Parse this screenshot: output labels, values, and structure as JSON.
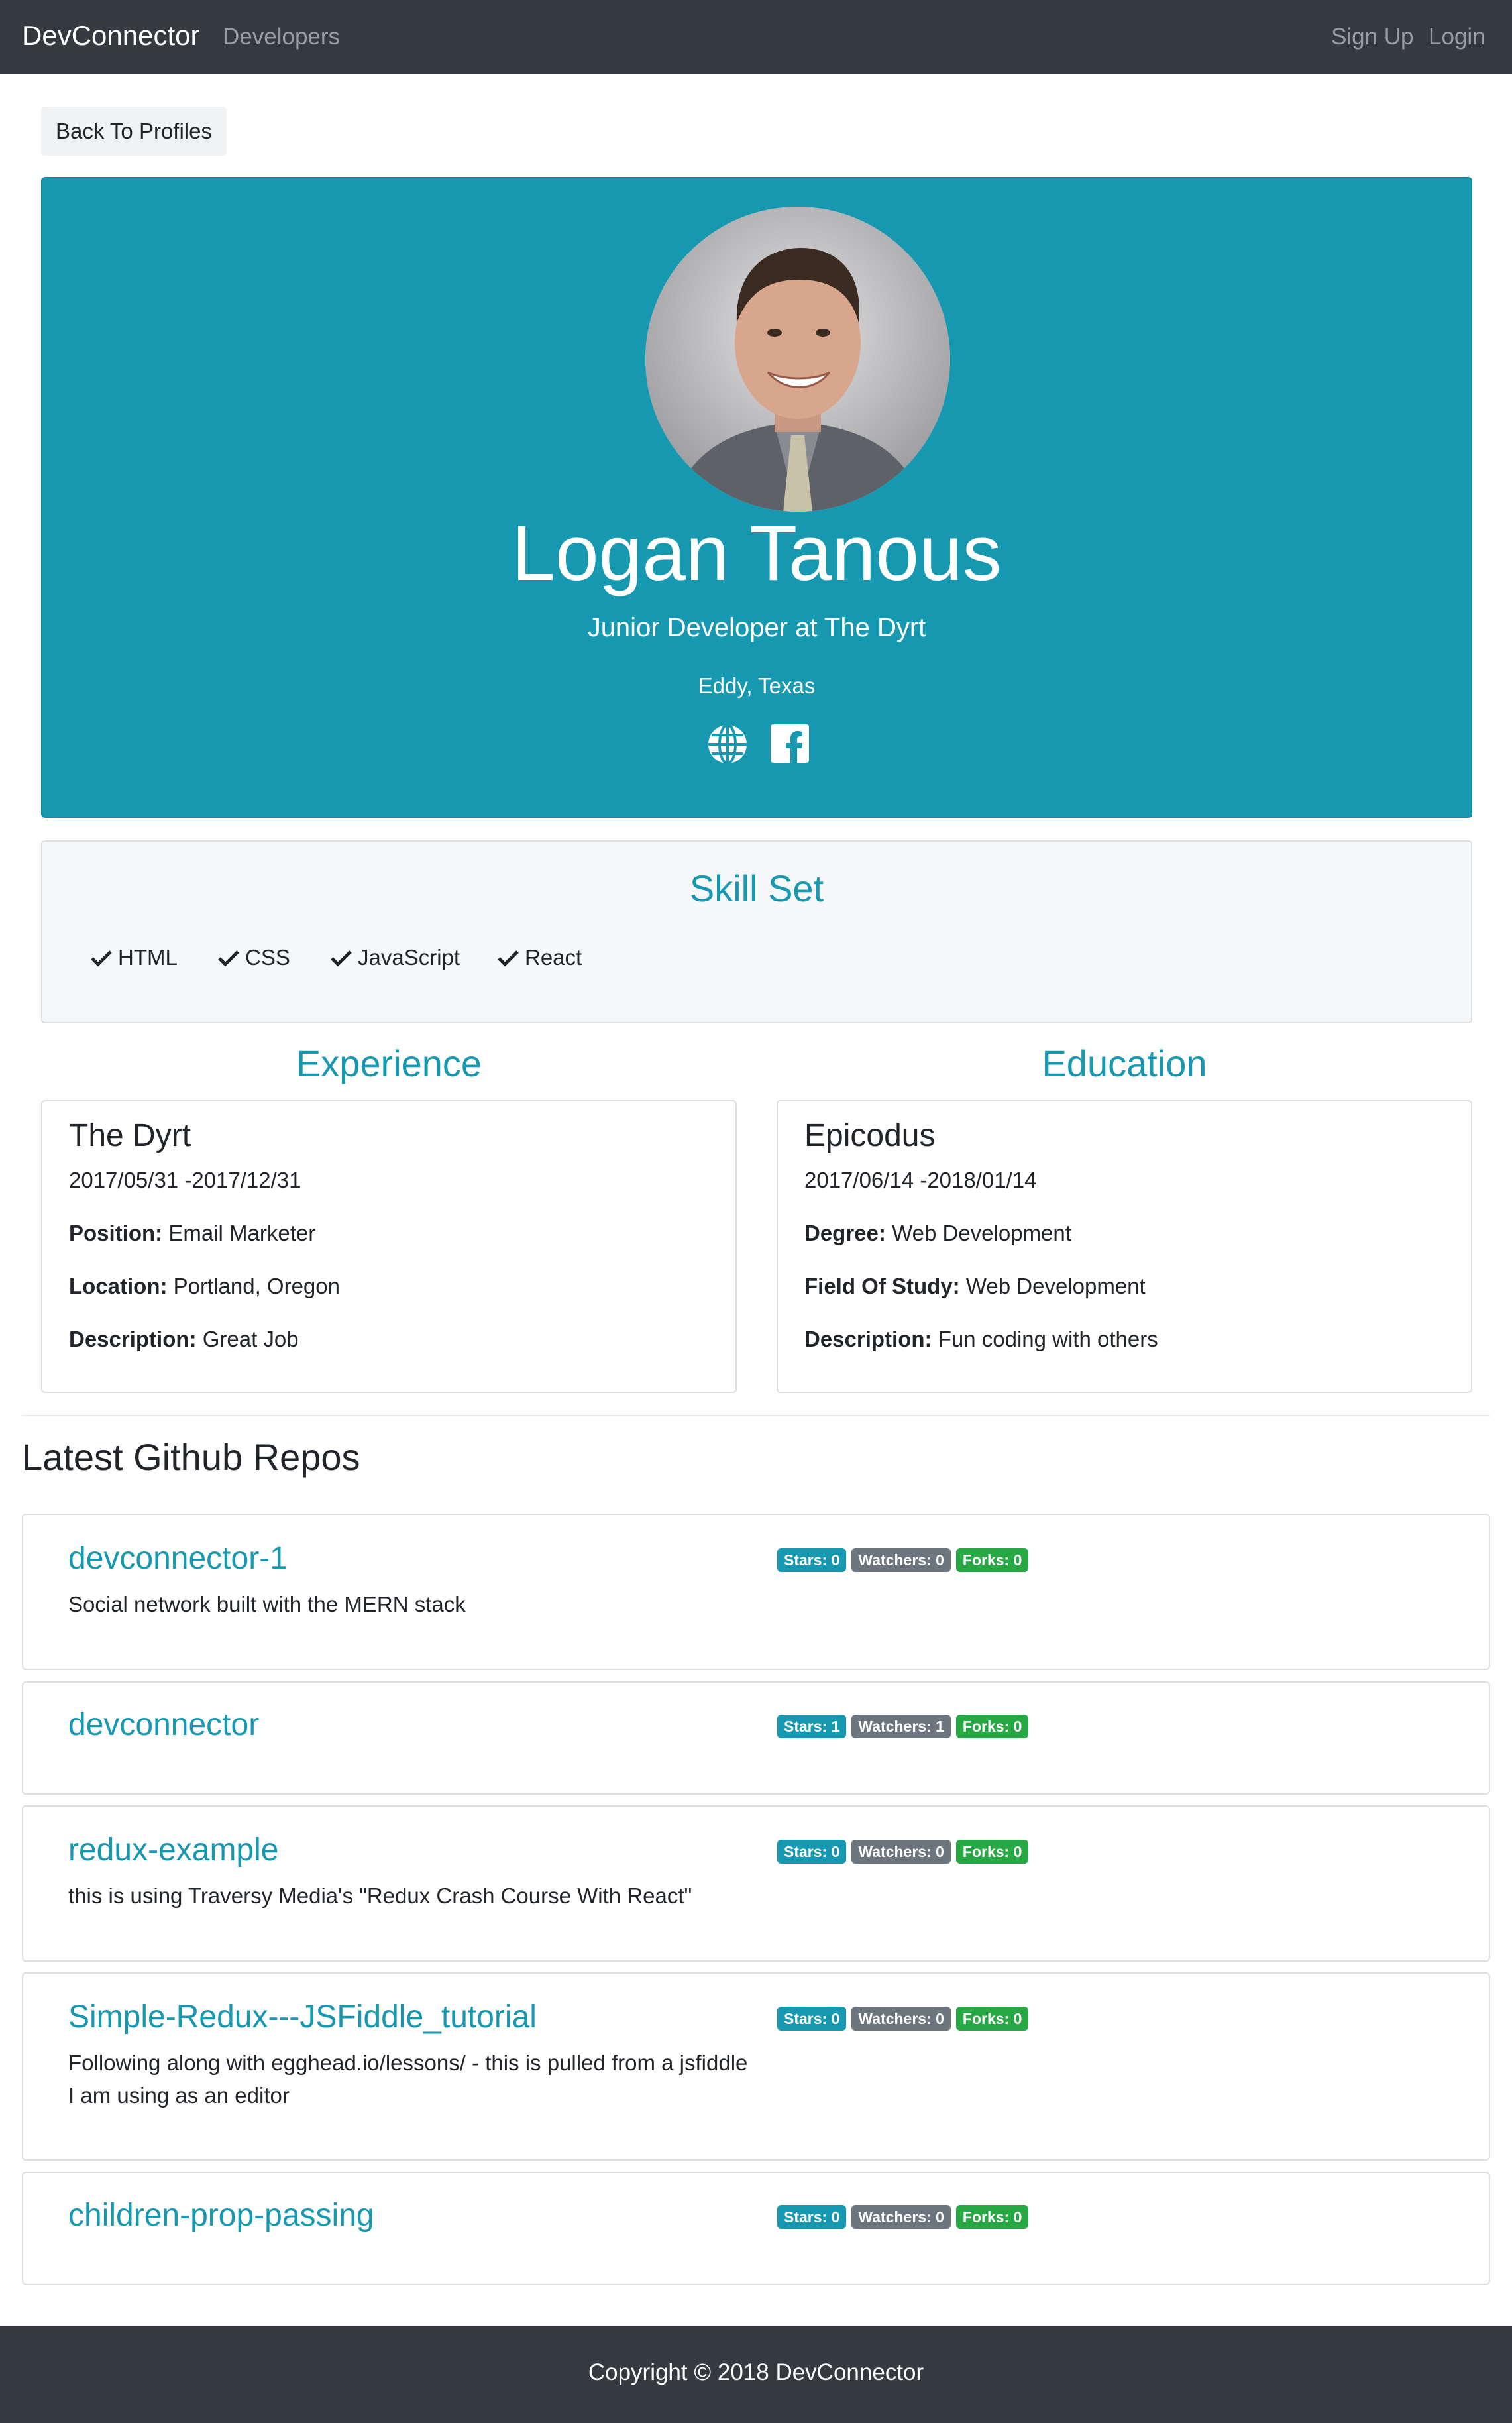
{
  "nav": {
    "brand": "DevConnector",
    "developers": "Developers",
    "sign_up": "Sign Up",
    "login": "Login"
  },
  "back_button": "Back To Profiles",
  "profile": {
    "name": "Logan Tanous",
    "title": "Junior Developer at The Dyrt",
    "location": "Eddy, Texas",
    "social_icons": [
      "globe-icon",
      "facebook-icon"
    ]
  },
  "skills": {
    "title": "Skill Set",
    "items": [
      "HTML",
      "CSS",
      "JavaScript",
      "React"
    ]
  },
  "experience": {
    "title": "Experience",
    "company": "The Dyrt",
    "dates": "2017/05/31 -2017/12/31",
    "position_label": "Position:",
    "position": "Email Marketer",
    "location_label": "Location:",
    "location": "Portland, Oregon",
    "description_label": "Description:",
    "description": "Great Job"
  },
  "education": {
    "title": "Education",
    "school": "Epicodus",
    "dates": "2017/06/14 -2018/01/14",
    "degree_label": "Degree:",
    "degree": "Web Development",
    "field_label": "Field Of Study:",
    "field": "Web Development",
    "description_label": "Description:",
    "description": "Fun coding with others"
  },
  "repos": {
    "title": "Latest Github Repos",
    "items": [
      {
        "name": "devconnector-1",
        "description": "Social network built with the MERN stack",
        "stars": "Stars: 0",
        "watchers": "Watchers: 0",
        "forks": "Forks: 0"
      },
      {
        "name": "devconnector",
        "description": "",
        "stars": "Stars: 1",
        "watchers": "Watchers: 1",
        "forks": "Forks: 0"
      },
      {
        "name": "redux-example",
        "description": "this is using Traversy Media's \"Redux Crash Course With React\"",
        "stars": "Stars: 0",
        "watchers": "Watchers: 0",
        "forks": "Forks: 0"
      },
      {
        "name": "Simple-Redux---JSFiddle_tutorial",
        "description": "Following along with egghead.io/lessons/ - this is pulled from a jsfiddle I am using as an editor",
        "stars": "Stars: 0",
        "watchers": "Watchers: 0",
        "forks": "Forks: 0"
      },
      {
        "name": "children-prop-passing",
        "description": "",
        "stars": "Stars: 0",
        "watchers": "Watchers: 0",
        "forks": "Forks: 0"
      }
    ]
  },
  "badge_colors": {
    "stars": "#1698b0",
    "watchers": "#6c757d",
    "forks": "#28a745"
  },
  "footer": "Copyright © 2018 DevConnector"
}
